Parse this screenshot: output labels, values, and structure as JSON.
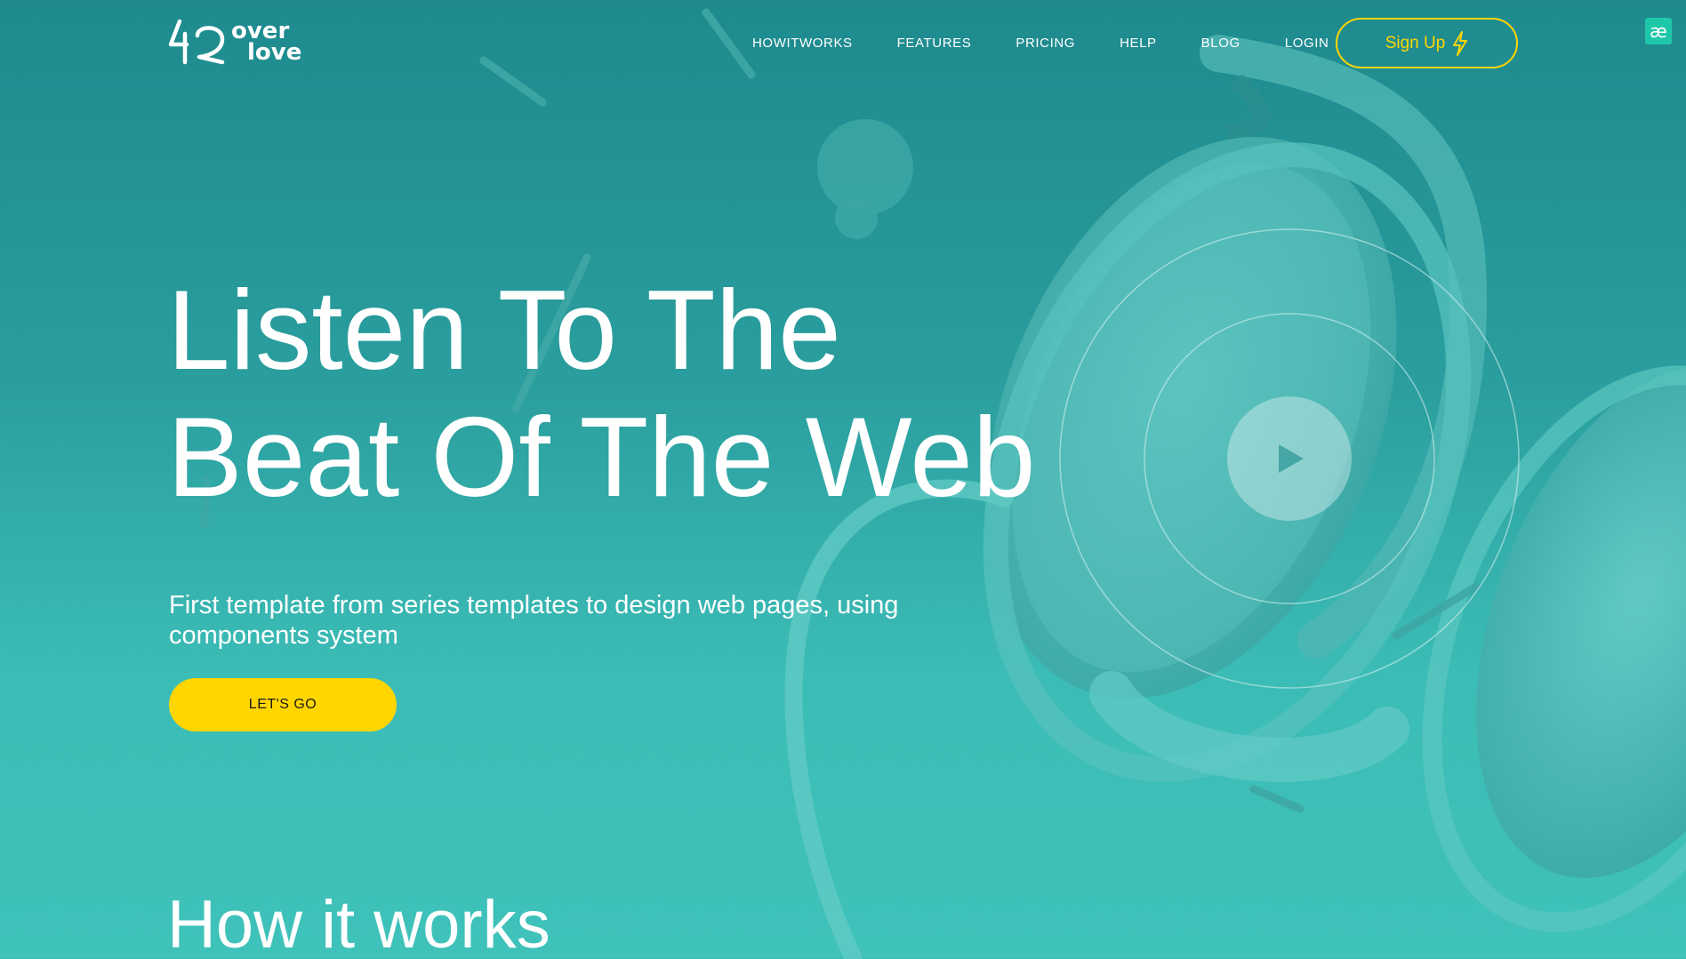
{
  "brand": {
    "logo_number": "42",
    "logo_word_1": "over",
    "logo_word_2": "love"
  },
  "nav": {
    "items": [
      {
        "label": "HOWITWORKS"
      },
      {
        "label": "FEATURES"
      },
      {
        "label": "PRICING"
      },
      {
        "label": "HELP"
      },
      {
        "label": "BLOG"
      },
      {
        "label": "LOGIN"
      }
    ],
    "signup_label": "Sign Up",
    "signup_icon": "lightning-icon"
  },
  "extension_badge": {
    "label": "æ"
  },
  "hero": {
    "title_line_1": "Listen To The",
    "title_line_2": "Beat Of The Web",
    "subtitle": "First template from series templates to design web pages, using components system",
    "cta_label": "LET'S GO",
    "play_icon": "play-icon"
  },
  "section": {
    "title": "How it works"
  },
  "colors": {
    "accent": "#ffd600",
    "background_top": "#1e8a8e",
    "background_bottom": "#3fc2ba",
    "badge": "#1fc7a9"
  }
}
